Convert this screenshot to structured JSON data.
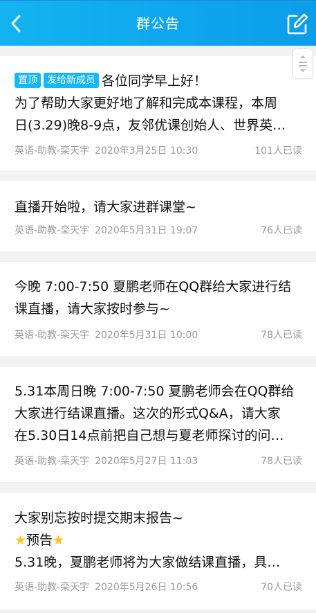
{
  "header": {
    "title": "群公告",
    "accent_color": "#10aaef",
    "back_icon": "chevron-left-icon",
    "edit_icon": "edit-icon"
  },
  "announcements": [
    {
      "tags": [
        "置顶",
        "发给新成员"
      ],
      "lines": [
        "各位同学早上好！",
        "为了帮助大家更好地了解和完成本课程，本周",
        "日(3.29)晚8-9点，友邻优课创始人、世界英…"
      ],
      "author": "英语-助教-栾天宇",
      "time": "2020年3月25日 10:30",
      "reads": "101人已读"
    },
    {
      "lines": [
        "直播开始啦，请大家进群课堂~"
      ],
      "author": "英语-助教-栾天宇",
      "time": "2020年5月31日 19:07",
      "reads": "76人已读"
    },
    {
      "lines": [
        "今晚 7:00-7:50 夏鹏老师在QQ群给大家进行结",
        "课直播，请大家按时参与~"
      ],
      "author": "英语-助教-栾天宇",
      "time": "2020年5月31日 10:00",
      "reads": "78人已读"
    },
    {
      "lines": [
        "5.31本周日晚 7:00-7:50 夏鹏老师会在QQ群给",
        "大家进行结课直播。这次的形式Q&A，请大家",
        "在5.30日14点前把自己想与夏老师探讨的问…"
      ],
      "author": "英语-助教-栾天宇",
      "time": "2020年5月27日 11:03",
      "reads": "78人已读"
    },
    {
      "lines": [
        "大家别忘按时提交期末报告~",
        "预告",
        "5.31晚，夏鹏老师将为大家做结课直播，具…"
      ],
      "line2_icon": "star-icon",
      "author": "英语-助教-栾天宇",
      "time": "2020年5月26日 10:56",
      "reads": "70人已读"
    }
  ]
}
